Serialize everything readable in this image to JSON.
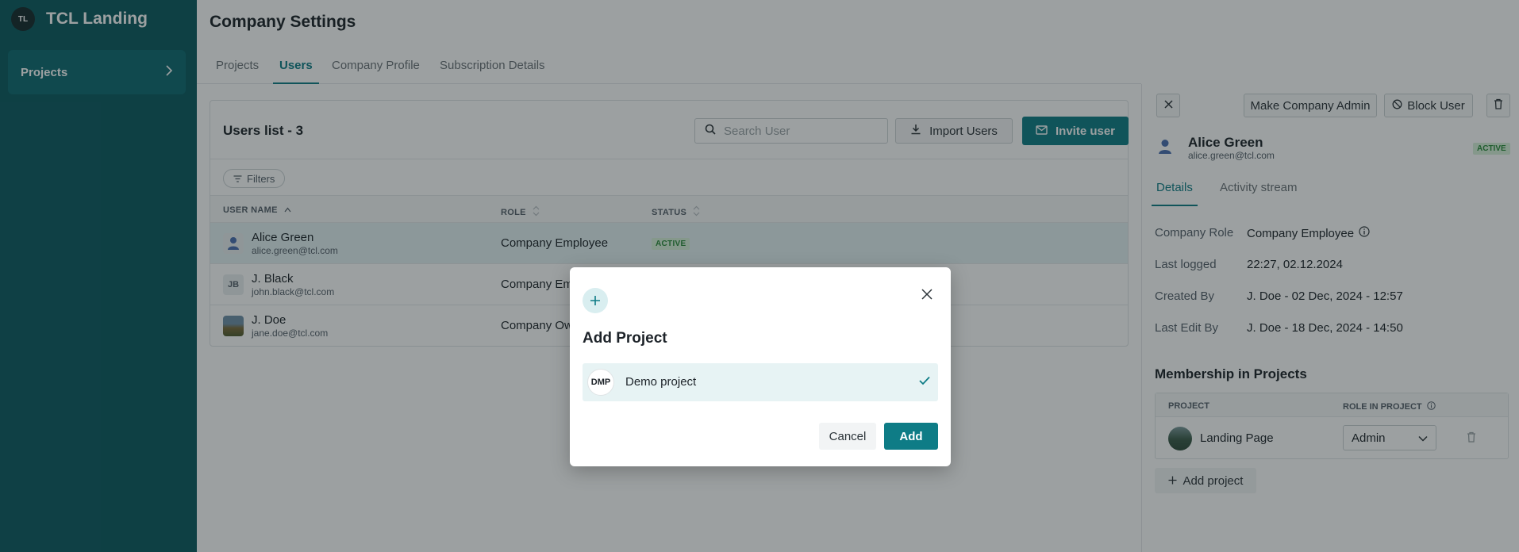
{
  "brand": {
    "logo_text": "TL",
    "name": "TCL Landing"
  },
  "sidebar": {
    "items": [
      {
        "label": "Projects",
        "icon": "chevron-right-icon"
      }
    ]
  },
  "page": {
    "title": "Company Settings",
    "tabs": [
      {
        "label": "Projects"
      },
      {
        "label": "Users",
        "active": true
      },
      {
        "label": "Company Profile"
      },
      {
        "label": "Subscription Details"
      }
    ]
  },
  "users": {
    "title": "Users list - 3",
    "search_placeholder": "Search User",
    "import_label": "Import Users",
    "invite_label": "Invite user",
    "filters_label": "Filters",
    "columns": {
      "name": "USER NAME",
      "role": "ROLE",
      "status": "STATUS"
    },
    "rows": [
      {
        "name": "Alice Green",
        "email": "alice.green@tcl.com",
        "role": "Company Employee",
        "status": "ACTIVE",
        "avatar": "person-icon"
      },
      {
        "name": "J. Black",
        "email": "john.black@tcl.com",
        "role": "Company Employee",
        "initials": "JB"
      },
      {
        "name": "J. Doe",
        "email": "jane.doe@tcl.com",
        "role": "Company Owner",
        "avatar": "photo"
      }
    ]
  },
  "panel": {
    "make_admin_label": "Make Company Admin",
    "block_label": "Block User",
    "user_name": "Alice Green",
    "user_email": "alice.green@tcl.com",
    "status": "ACTIVE",
    "tabs": [
      {
        "label": "Details",
        "active": true
      },
      {
        "label": "Activity stream"
      }
    ],
    "details": {
      "company_role_label": "Company Role",
      "company_role_value": "Company Employee",
      "last_logged_label": "Last logged",
      "last_logged_value": "22:27, 02.12.2024",
      "created_by_label": "Created By",
      "created_by_value": "J. Doe - 02 Dec, 2024 - 12:57",
      "last_edit_label": "Last Edit By",
      "last_edit_value": "J. Doe - 18 Dec, 2024 - 14:50"
    },
    "membership_title": "Membership in Projects",
    "membership_columns": {
      "project": "PROJECT",
      "role": "ROLE IN PROJECT"
    },
    "membership_rows": [
      {
        "project": "Landing Page",
        "role": "Admin"
      }
    ],
    "add_project_label": "Add project"
  },
  "modal": {
    "title": "Add Project",
    "option_badge": "DMP",
    "option_name": "Demo project",
    "option_selected": true,
    "cancel_label": "Cancel",
    "add_label": "Add"
  },
  "colors": {
    "accent": "#0e7c86",
    "sidebar": "#0c5a60",
    "active_badge": "#d7f2da"
  }
}
